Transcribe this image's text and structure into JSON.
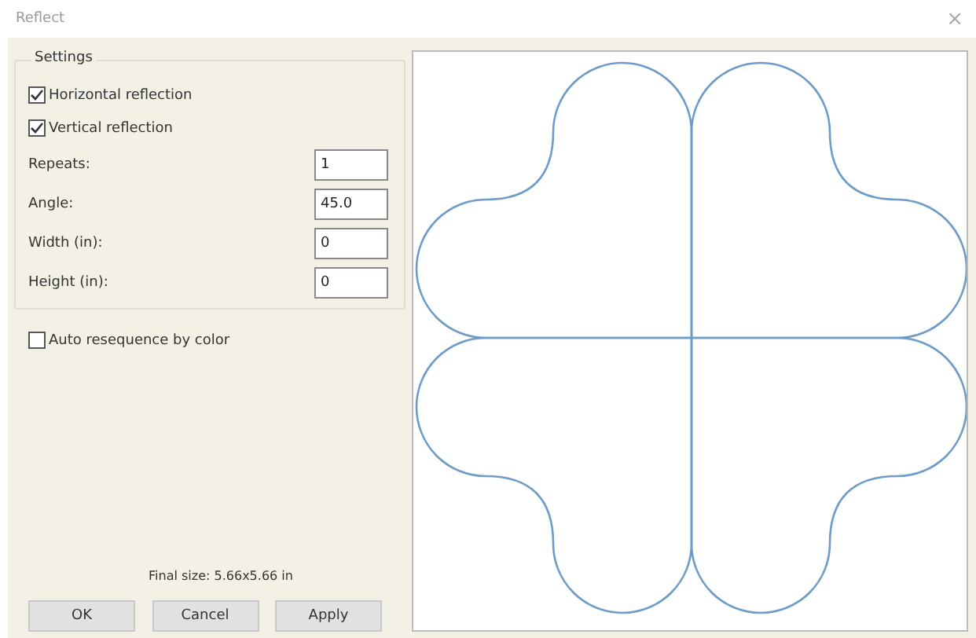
{
  "window": {
    "title": "Reflect",
    "close": "×"
  },
  "settings": {
    "legend": "Settings",
    "checkboxes": [
      {
        "label": "Horizontal reflection",
        "checked": true
      },
      {
        "label": "Vertical reflection",
        "checked": true
      }
    ],
    "fields": [
      {
        "label": "Repeats:",
        "value": "1"
      },
      {
        "label": "Angle:",
        "value": "45.0"
      },
      {
        "label": "Width (in):",
        "value": "0"
      },
      {
        "label": "Height (in):",
        "value": "0"
      }
    ]
  },
  "auto_resequence": {
    "label": "Auto resequence by color",
    "checked": false
  },
  "final_size": "Final size: 5.66x5.66 in",
  "buttons": [
    "OK",
    "Cancel",
    "Apply"
  ]
}
